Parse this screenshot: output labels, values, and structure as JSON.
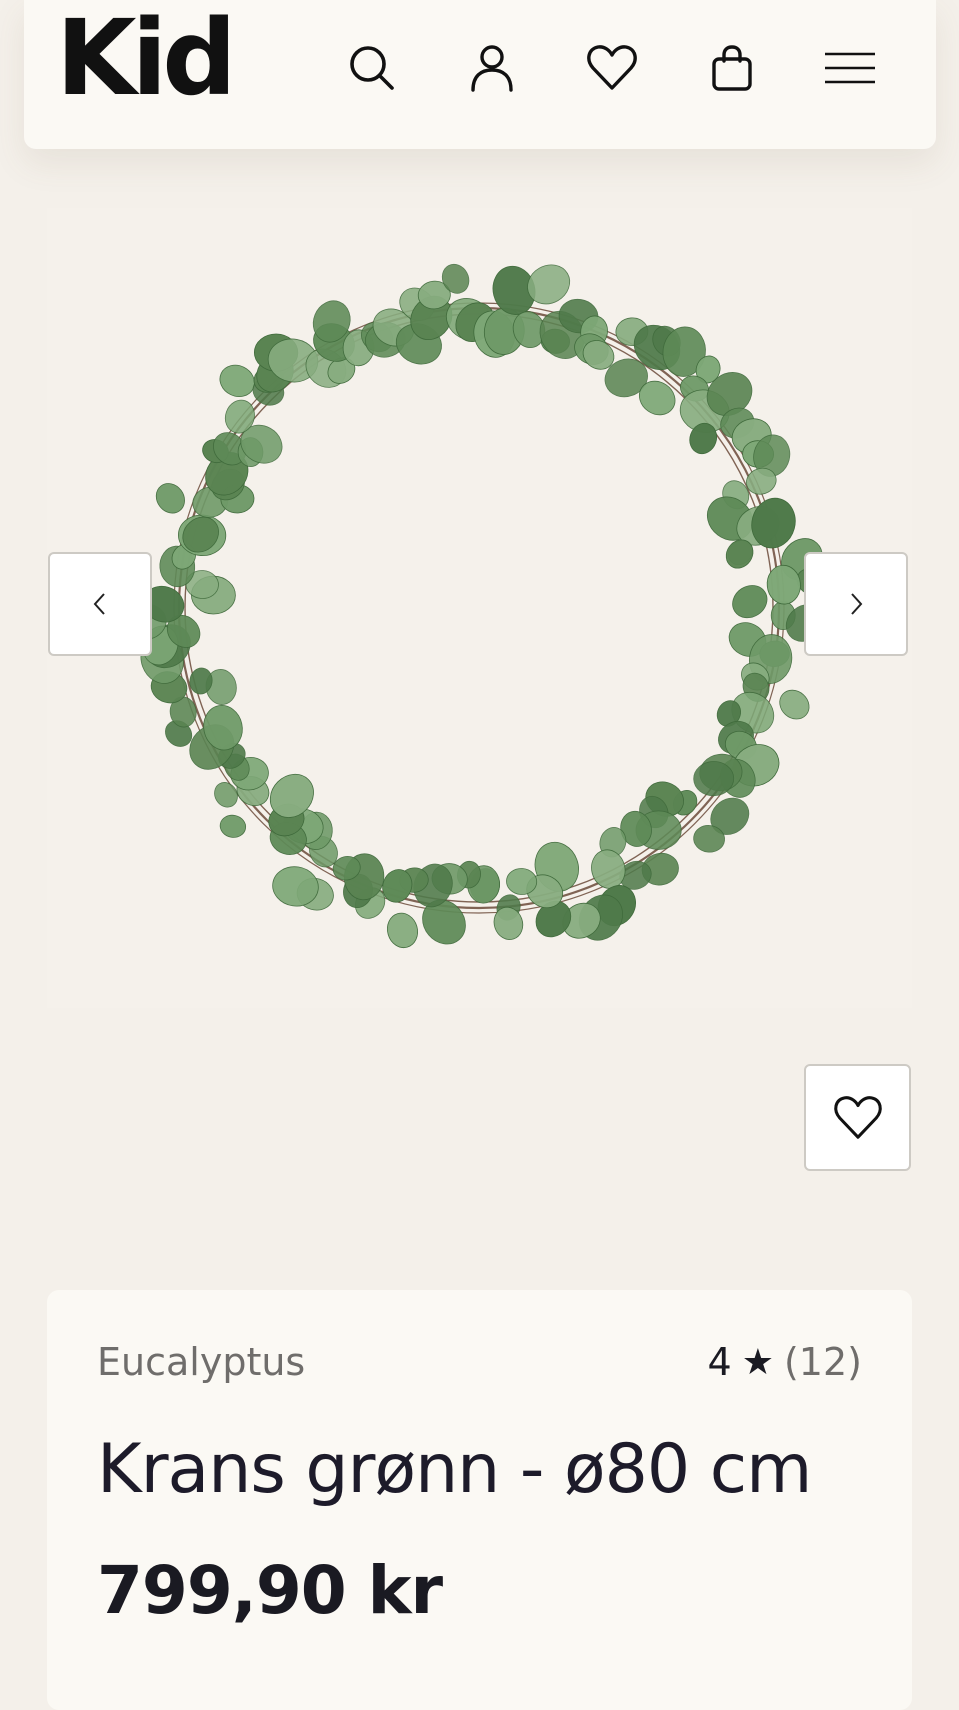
{
  "header": {
    "logo": "Kid",
    "icons": [
      "search-icon",
      "account-icon",
      "wishlist-icon",
      "cart-icon",
      "menu-icon"
    ]
  },
  "gallery": {
    "image": "eucalyptus-wreath",
    "prev_icon": "chevron-left-icon",
    "next_icon": "chevron-right-icon",
    "favorite_icon": "heart-icon"
  },
  "product": {
    "brand": "Eucalyptus",
    "rating": "4",
    "rating_star": "★",
    "review_count": "(12)",
    "title": "Krans grønn - ø80 cm",
    "price": "799,90 kr"
  },
  "colors": {
    "background": "#f4f0ea",
    "card": "#fbf9f4",
    "text": "#1a1a22",
    "muted": "#6f6d6b",
    "leaf": "#5e8a57",
    "stem": "#6b4a3a"
  }
}
